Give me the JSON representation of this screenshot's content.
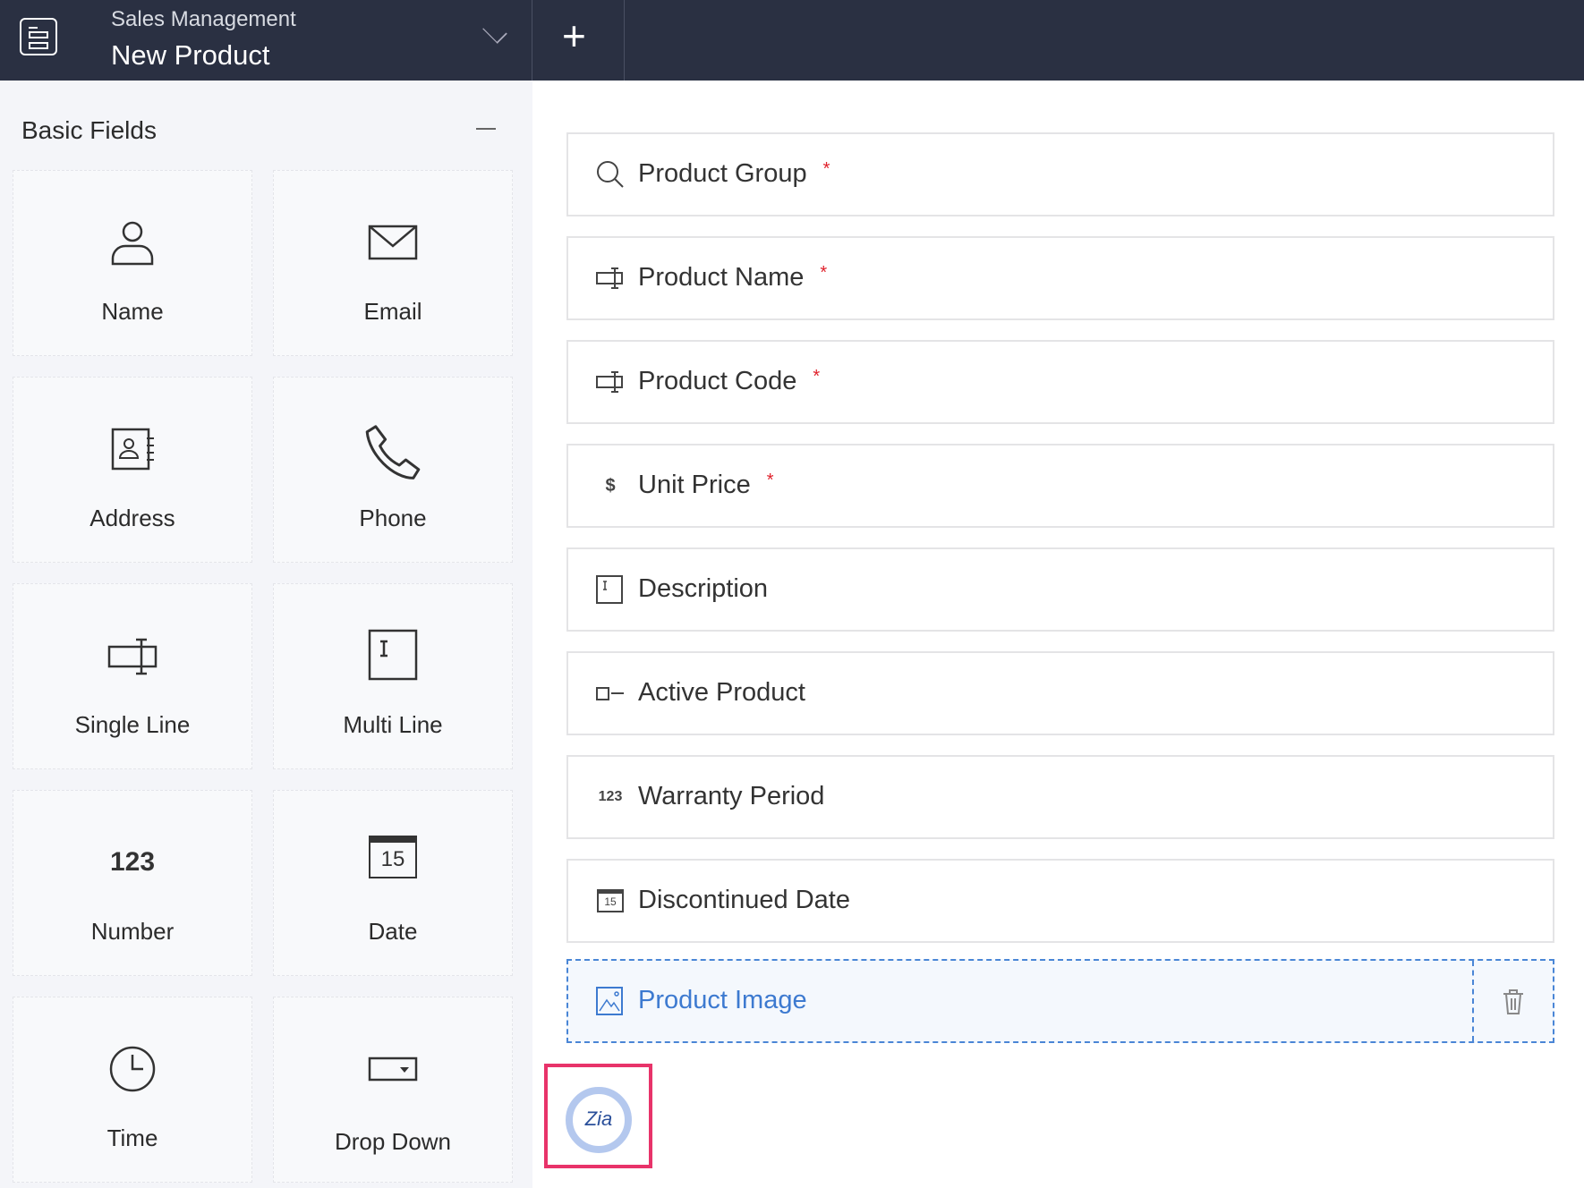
{
  "header": {
    "app_name": "Sales Management",
    "form_title": "New Product"
  },
  "sidebar": {
    "section_title": "Basic Fields",
    "tiles": [
      {
        "label": "Name",
        "icon": "person-icon"
      },
      {
        "label": "Email",
        "icon": "envelope-icon"
      },
      {
        "label": "Address",
        "icon": "address-card-icon"
      },
      {
        "label": "Phone",
        "icon": "phone-icon"
      },
      {
        "label": "Single Line",
        "icon": "single-line-icon"
      },
      {
        "label": "Multi Line",
        "icon": "multi-line-icon"
      },
      {
        "label": "Number",
        "icon": "number-icon",
        "glyph": "123"
      },
      {
        "label": "Date",
        "icon": "calendar-icon",
        "glyph": "15"
      },
      {
        "label": "Time",
        "icon": "clock-icon"
      },
      {
        "label": "Drop Down",
        "icon": "dropdown-icon"
      }
    ]
  },
  "form": {
    "fields": [
      {
        "label": "Product Group",
        "required": "*"
      },
      {
        "label": "Product Name",
        "required": "*"
      },
      {
        "label": "Product Code",
        "required": "*"
      },
      {
        "label": "Unit Price",
        "required": "*",
        "glyph": "$"
      },
      {
        "label": "Description"
      },
      {
        "label": "Active Product"
      },
      {
        "label": "Warranty Period",
        "glyph": "123"
      },
      {
        "label": "Discontinued Date",
        "glyph": "15"
      },
      {
        "label": "Product Image"
      }
    ]
  },
  "zia": {
    "label": "Zia"
  },
  "colors": {
    "header": "#2a3042",
    "accent": "#3d7ad0",
    "required": "#e0212b",
    "highlight": "#e8336a"
  }
}
